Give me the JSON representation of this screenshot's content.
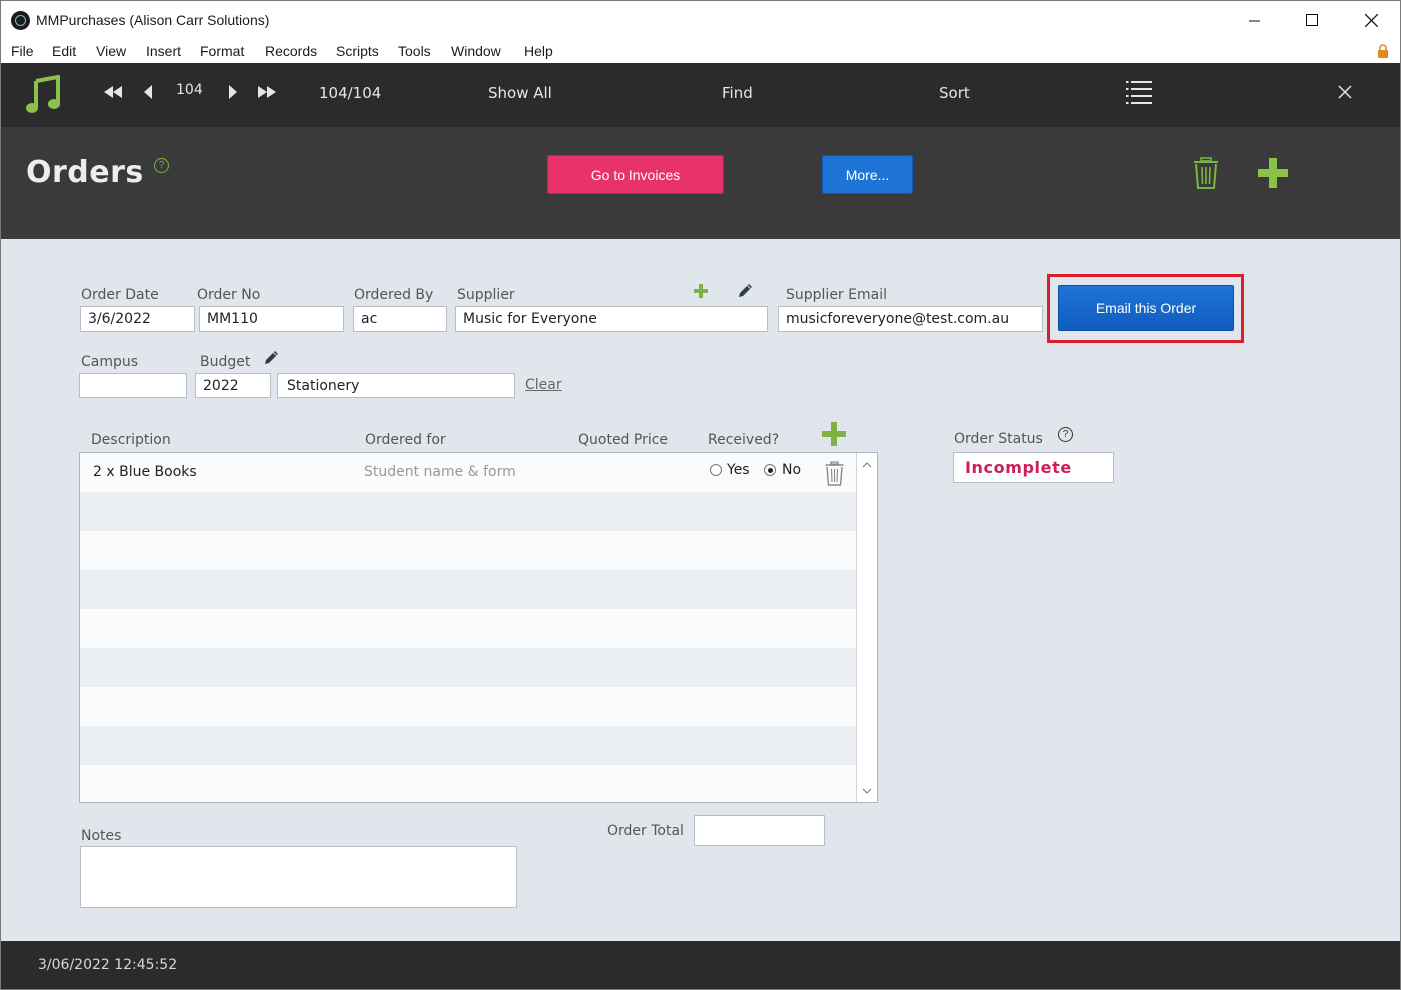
{
  "window": {
    "title": "MMPurchases (Alison Carr Solutions)",
    "controls": [
      "minimize",
      "maximize",
      "close"
    ]
  },
  "menu": [
    "File",
    "Edit",
    "View",
    "Insert",
    "Format",
    "Records",
    "Scripts",
    "Tools",
    "Window",
    "Help"
  ],
  "toolbar": {
    "record_number": "104",
    "record_count": "104/104",
    "show_all": "Show All",
    "find": "Find",
    "sort": "Sort",
    "icons": [
      "music-note-icon",
      "first-record-icon",
      "previous-record-icon",
      "next-record-icon",
      "last-record-icon",
      "list-view-icon",
      "close-icon"
    ]
  },
  "header": {
    "title": "Orders",
    "help": "?",
    "go_to_invoices": "Go to Invoices",
    "more": "More...",
    "icons": [
      "trash-icon",
      "add-icon"
    ]
  },
  "form": {
    "order_date_label": "Order Date",
    "order_date": "3/6/2022",
    "order_no_label": "Order No",
    "order_no": "MM110",
    "ordered_by_label": "Ordered By",
    "ordered_by": "ac",
    "supplier_label": "Supplier",
    "supplier": "Music for Everyone",
    "supplier_email_label": "Supplier Email",
    "supplier_email": "musicforeveryone@test.com.au",
    "email_button": "Email this Order",
    "campus_label": "Campus",
    "campus": "",
    "budget_label": "Budget",
    "budget_year": "2022",
    "budget_name": "Stationery",
    "clear": "Clear"
  },
  "items": {
    "headers": {
      "description": "Description",
      "ordered_for": "Ordered for",
      "quoted_price": "Quoted Price",
      "received": "Received?"
    },
    "rows": [
      {
        "description": "2 x Blue Books",
        "ordered_for_placeholder": "Student name & form",
        "quoted_price": "",
        "yes_label": "Yes",
        "no_label": "No",
        "received": "No"
      }
    ]
  },
  "status": {
    "label": "Order Status",
    "help": "?",
    "value": "Incomplete"
  },
  "notes": {
    "label": "Notes",
    "value": ""
  },
  "total": {
    "label": "Order Total",
    "value": ""
  },
  "footer": {
    "timestamp": "3/06/2022 12:45:52"
  },
  "colors": {
    "accent_pink": "#e8336a",
    "accent_blue": "#1e73d6",
    "accent_green": "#7cb342",
    "status_text": "#cc1f55",
    "highlight_red": "#d9202c"
  }
}
